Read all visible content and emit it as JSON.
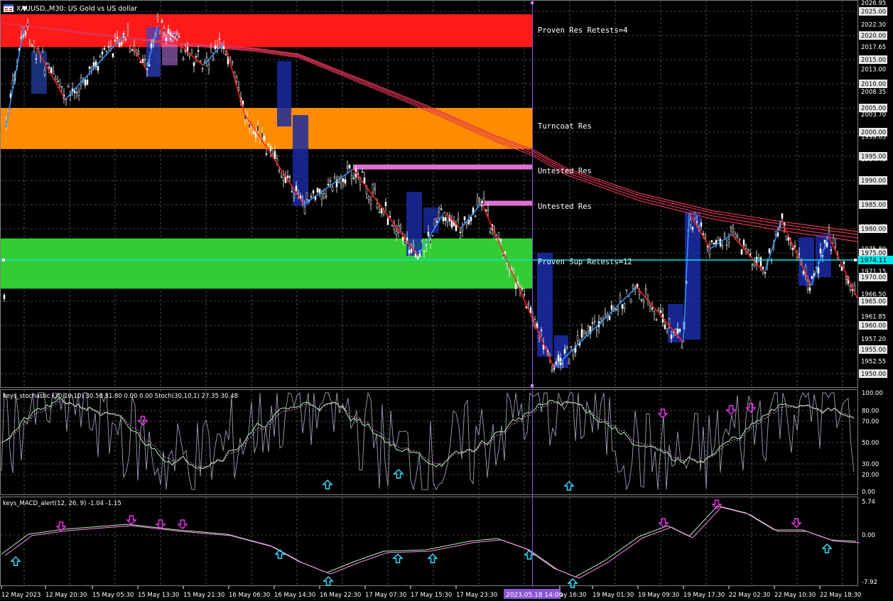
{
  "window": {
    "symbol_title": "XAUUSD,,M30: US Gold vs US dollar",
    "icon": "chart-window-icon"
  },
  "zones": [
    {
      "label": "Proven Res  Retests=4",
      "color": "#ff1a1a",
      "top": 2024.4,
      "bottom": 2017.6
    },
    {
      "label": "Turncoat Res",
      "color": "#ff8c00",
      "top": 2005.0,
      "bottom": 1996.5
    },
    {
      "label": "Untested Res",
      "color": "#e070d0",
      "top": 1993.3,
      "bottom": 1992.3
    },
    {
      "label": "Untested Res",
      "color": "#e070d0",
      "top": 1985.8,
      "bottom": 1984.8
    },
    {
      "label": "Proven Sup  Retests=12",
      "color": "#33cc33",
      "top": 1978.0,
      "bottom": 1967.6
    }
  ],
  "price_axis": {
    "top_value": "2026.95",
    "ticks": [
      "2022.30",
      "2017.65",
      "2013.00",
      "2008.35",
      "2003.70",
      "1999.05",
      "1994.40",
      "1989.75",
      "1985.10",
      "1980.45",
      "1975.80",
      "1971.15",
      "1966.50",
      "1961.85",
      "1957.20",
      "1952.55"
    ],
    "highlight_ticks": [
      "2025.00",
      "2020.00",
      "2015.00",
      "2010.00",
      "2005.00",
      "2000.00",
      "1995.00",
      "1990.00",
      "1985.00",
      "1980.00",
      "1975.00",
      "1970.00",
      "1965.00",
      "1960.00",
      "1955.00",
      "1950.00"
    ],
    "current_price": "1974.11",
    "current_price_color": "#00e5e5"
  },
  "stochastic": {
    "header": "keys_stochastic (30,10,10) 30.50 31.80 0.00 0.00 Stoch(30,10,1) 27.35 30.48",
    "levels": [
      "100.00",
      "80.00",
      "70.00",
      "50.00",
      "30.00",
      "20.00",
      "0.00"
    ]
  },
  "macd": {
    "header": "keys_MACD_alert(12, 26, 9) -1.04 -1.15",
    "levels": [
      "5.74",
      "0.00",
      "-7.92"
    ]
  },
  "time_axis": {
    "labels": [
      "12 May 2023",
      "12 May 20:30",
      "15 May 05:30",
      "15 May 13:30",
      "15 May 21:30",
      "16 May 06:30",
      "16 May 14:30",
      "16 May 22:30",
      "17 May 07:30",
      "17 May 15:30",
      "17 May 23:30",
      "ay 16:30",
      "19 May 01:30",
      "19 May 09:30",
      "19 May 17:30",
      "22 May 02:30",
      "22 May 10:30",
      "22 May 18:30"
    ],
    "cursor_label": "2023.05.18 14:00",
    "cursor_color": "#8a55d8"
  },
  "colors": {
    "grid": "#7f7f7f",
    "zigzag_up": "#3399ff",
    "zigzag_down": "#ff2020",
    "ma": "#dd3355",
    "candle": "#ffffff",
    "arrow_up": "#33ddff",
    "arrow_down": "#ee33ee"
  }
}
